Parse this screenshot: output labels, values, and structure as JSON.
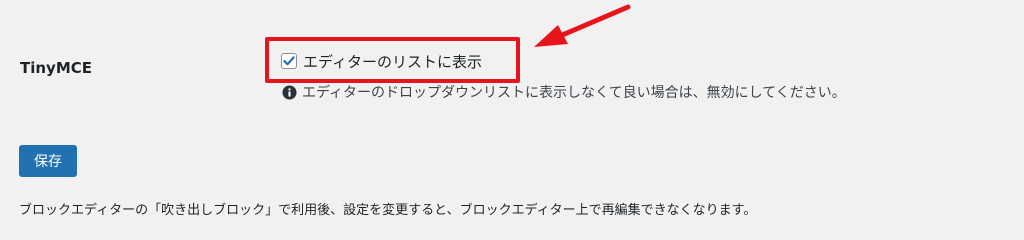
{
  "setting": {
    "label": "TinyMCE",
    "option_label": "エディターのリストに表示",
    "option_checked": true,
    "description": "エディターのドロップダウンリストに表示しなくて良い場合は、無効にしてください。",
    "info_icon": "info-icon"
  },
  "actions": {
    "save_label": "保存"
  },
  "footnote": "ブロックエディターの「吹き出しブロック」で利用後、設定を変更すると、ブロックエディター上で再編集できなくなります。",
  "colors": {
    "background": "#f1f1f1",
    "primary_button": "#2271b1",
    "annotation_red": "#e8141c"
  }
}
